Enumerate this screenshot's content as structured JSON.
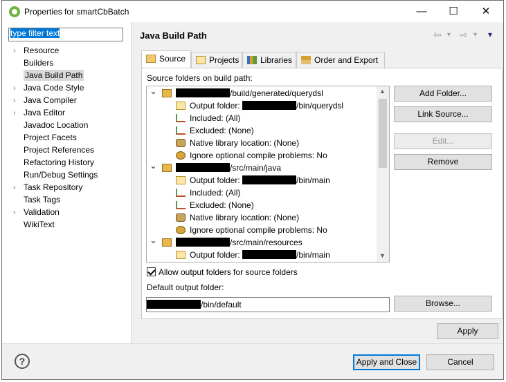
{
  "window": {
    "title": "Properties for smartCbBatch",
    "minimize_glyph": "—",
    "maximize_glyph": "☐",
    "close_glyph": "✕"
  },
  "filter": {
    "value": "type filter text"
  },
  "nav": {
    "items": [
      {
        "label": "Resource",
        "expandable": true
      },
      {
        "label": "Builders",
        "expandable": false
      },
      {
        "label": "Java Build Path",
        "expandable": false,
        "selected": true
      },
      {
        "label": "Java Code Style",
        "expandable": true
      },
      {
        "label": "Java Compiler",
        "expandable": true
      },
      {
        "label": "Java Editor",
        "expandable": true
      },
      {
        "label": "Javadoc Location",
        "expandable": false
      },
      {
        "label": "Project Facets",
        "expandable": false
      },
      {
        "label": "Project References",
        "expandable": false
      },
      {
        "label": "Refactoring History",
        "expandable": false
      },
      {
        "label": "Run/Debug Settings",
        "expandable": false
      },
      {
        "label": "Task Repository",
        "expandable": true
      },
      {
        "label": "Task Tags",
        "expandable": false
      },
      {
        "label": "Validation",
        "expandable": true
      },
      {
        "label": "WikiText",
        "expandable": false
      }
    ]
  },
  "page": {
    "title": "Java Build Path",
    "nav_back": "⇦",
    "nav_forward": "⇨",
    "nav_dropdown": "▾",
    "menu": "▾"
  },
  "tabs": [
    {
      "label": "Source",
      "active": true
    },
    {
      "label": "Projects",
      "active": false
    },
    {
      "label": "Libraries",
      "active": false
    },
    {
      "label": "Order and Export",
      "active": false
    }
  ],
  "source": {
    "label": "Source folders on build path:",
    "tree": [
      {
        "kind": "folder",
        "suffix": "/build/generated/querydsl",
        "redact_w": 78
      },
      {
        "kind": "out",
        "prefix": "Output folder: ",
        "suffix": "/bin/querydsl",
        "redact_w": 78
      },
      {
        "kind": "filter",
        "text": "Included: (All)"
      },
      {
        "kind": "filter",
        "text": "Excluded: (None)"
      },
      {
        "kind": "native",
        "text": "Native library location: (None)"
      },
      {
        "kind": "gear",
        "text": "Ignore optional compile problems: No"
      },
      {
        "kind": "folder",
        "suffix": "/src/main/java",
        "redact_w": 78
      },
      {
        "kind": "out",
        "prefix": "Output folder: ",
        "suffix": "/bin/main",
        "redact_w": 78
      },
      {
        "kind": "filter",
        "text": "Included: (All)"
      },
      {
        "kind": "filter",
        "text": "Excluded: (None)"
      },
      {
        "kind": "native",
        "text": "Native library location: (None)"
      },
      {
        "kind": "gear",
        "text": "Ignore optional compile problems: No"
      },
      {
        "kind": "folder",
        "suffix": "/src/main/resources",
        "redact_w": 78
      },
      {
        "kind": "out",
        "prefix": "Output folder: ",
        "suffix": "/bin/main",
        "redact_w": 78
      }
    ],
    "buttons": {
      "add_folder": "Add Folder...",
      "link_source": "Link Source...",
      "edit": "Edit...",
      "remove": "Remove"
    },
    "allow_output_label": "Allow output folders for source folders",
    "allow_output_checked": true,
    "default_output_label": "Default output folder:",
    "default_output_suffix": "/bin/default",
    "browse": "Browse..."
  },
  "footer": {
    "apply": "Apply",
    "apply_close": "Apply and Close",
    "cancel": "Cancel",
    "help_glyph": "?"
  },
  "colors": {
    "accent": "#0078d7",
    "spring_green": "#6db33f",
    "panel_bg": "#f0f0f0"
  }
}
